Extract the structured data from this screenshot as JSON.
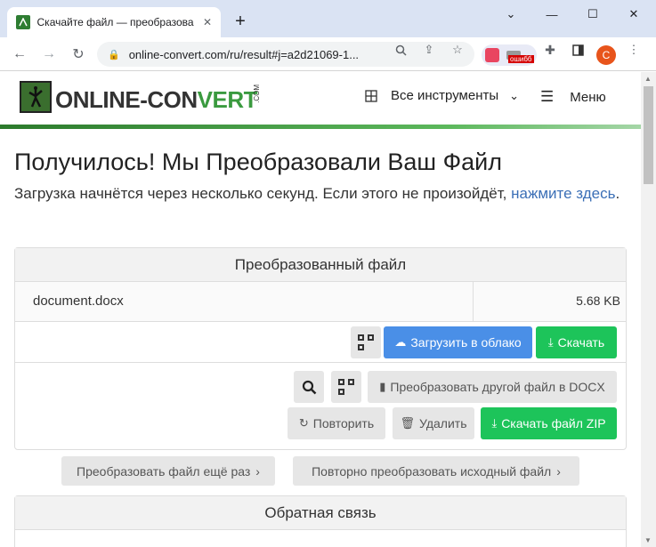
{
  "browser": {
    "tab_title": "Скачайте файл — преобразова",
    "url": "online-convert.com/ru/result#j=a2d21069-1...",
    "ext_badge": "oшибб",
    "profile_initial": "C"
  },
  "header": {
    "logo_main": "ONLINE-CON",
    "logo_accent": "VERT",
    "logo_com": ".COM",
    "tools_label": "Все инструменты",
    "menu_label": "Меню"
  },
  "main": {
    "title": "Получилось! Мы Преобразовали Ваш Файл",
    "lead_text": "Загрузка начнётся через несколько секунд. Если этого не произойдёт, ",
    "lead_link": "нажмите здесь",
    "lead_end": "."
  },
  "converted": {
    "heading": "Преобразованный файл",
    "file_name": "document.docx",
    "file_size": "5.68 KB",
    "upload_cloud": "Загрузить в облако",
    "download": "Скачать",
    "convert_other": "Преобразовать другой файл в DOCX",
    "repeat": "Повторить",
    "delete": "Удалить",
    "download_zip": "Скачать файл ZIP"
  },
  "bottom": {
    "convert_again": "Преобразовать файл ещё раз",
    "reconvert_source": "Повторно преобразовать исходный файл"
  },
  "feedback": {
    "heading": "Обратная связь"
  },
  "colors": {
    "blue_button": "#4a8fe7",
    "green_button": "#1dc45a",
    "link": "#3b6fb6"
  }
}
